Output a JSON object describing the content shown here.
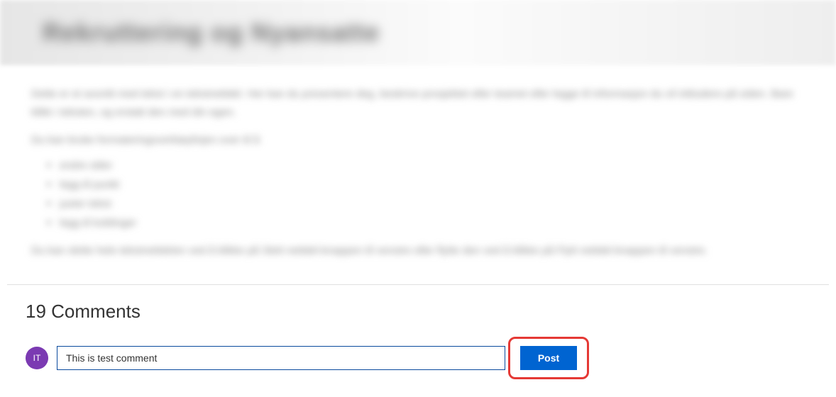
{
  "hero": {
    "title_blurred": "Rekruttering og Nyansatte"
  },
  "content": {
    "para1_blurred": "Dette er et avsnitt med tekst i en tekstnettdel. Her kan du presentere deg, beskrive prosjektet eller teamet eller legge til informasjon du vil inkludere på siden. Bare klikk i teksten, og erstatt den med din egen.",
    "para2_blurred": "Du kan bruke formateringsverktøylinjen over til å",
    "list_blurred": [
      "endre stiler",
      "legg til punkt",
      "juster tekst",
      "legg til koblinger"
    ],
    "para3_blurred": "Du kan slette hele tekstnettdelen ved å klikke på Slett nettdel-knappen til venstre eller flytte den ved å klikke på Flytt nettdel-knappen til venstre."
  },
  "comments": {
    "heading": "19 Comments",
    "avatar_initials": "IT",
    "input_value": "This is test comment",
    "post_button_label": "Post"
  }
}
